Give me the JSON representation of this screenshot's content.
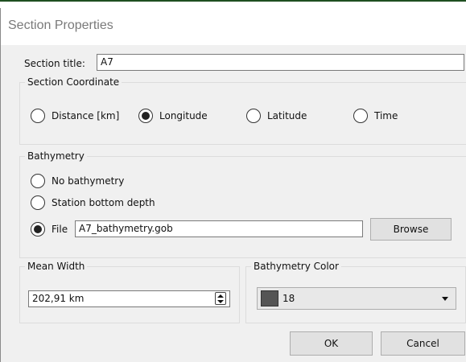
{
  "window": {
    "title": "Section Properties"
  },
  "section_title": {
    "label": "Section title:",
    "value": "A7"
  },
  "section_coordinate": {
    "group_label": "Section Coordinate",
    "options": [
      "Distance [km]",
      "Longitude",
      "Latitude",
      "Time"
    ],
    "selected": "Longitude"
  },
  "bathymetry": {
    "group_label": "Bathymetry",
    "options": [
      "No bathymetry",
      "Station bottom depth",
      "File"
    ],
    "selected": "File",
    "file_value": "A7_bathymetry.gob",
    "browse_label": "Browse"
  },
  "mean_width": {
    "group_label": "Mean Width",
    "value": "202,91 km"
  },
  "bathymetry_color": {
    "group_label": "Bathymetry Color",
    "value": "18",
    "swatch_color": "#555555"
  },
  "buttons": {
    "ok": "OK",
    "cancel": "Cancel"
  }
}
